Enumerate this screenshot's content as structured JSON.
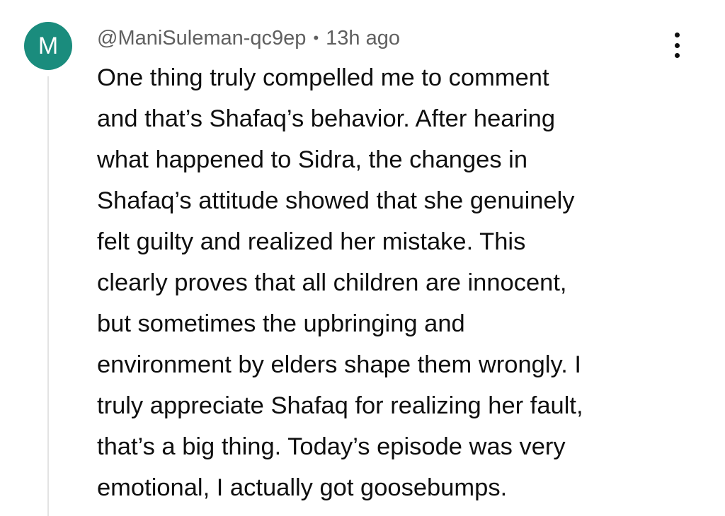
{
  "comment": {
    "avatar_letter": "M",
    "avatar_color": "#1a8c7d",
    "author": "@ManiSuleman-qc9ep",
    "separator": "•",
    "timestamp": "13h ago",
    "menu_icon": "more-vert-icon",
    "lines": [
      "One thing truly compelled me to comment",
      "and that’s Shafaq’s behavior. After hearing",
      "what happened to Sidra, the changes in",
      "Shafaq’s attitude showed that she genuinely",
      "felt guilty and realized her mistake. This",
      "clearly proves that all children are innocent,",
      "but sometimes the upbringing and",
      "environment by elders shape them wrongly. I",
      "truly appreciate Shafaq for realizing her fault,",
      "that’s a big thing. Today’s episode was very",
      "emotional, I actually got goosebumps."
    ]
  }
}
